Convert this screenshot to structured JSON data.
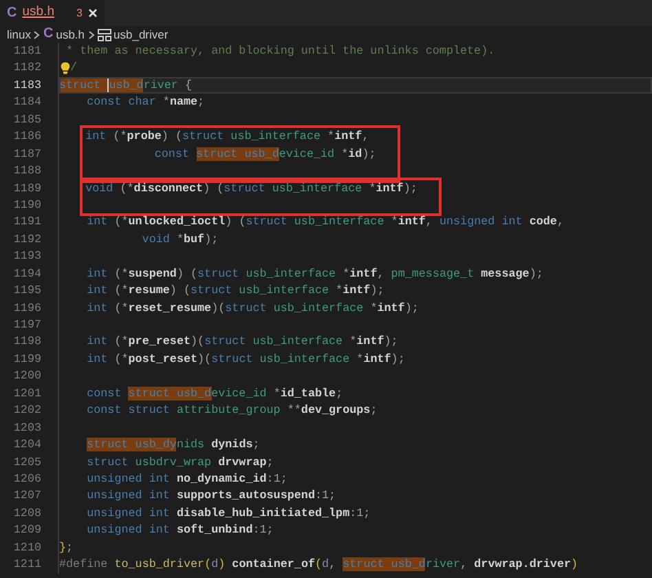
{
  "tabs": [
    {
      "icon": "C",
      "label": "usb.h",
      "problems": "3",
      "selected": true
    }
  ],
  "breadcrumb": [
    {
      "kind": "folder",
      "label": "linux"
    },
    {
      "kind": "file",
      "icon": "C",
      "label": "usb.h"
    },
    {
      "kind": "struct",
      "label": "usb_driver"
    }
  ],
  "code": {
    "blocks": [
      {
        "kind": "plain",
        "lines": [
          {
            "number": "1181",
            "selected": false,
            "tokens": [
              {
                "kind": "comment",
                "text": " * them as necessary, and blocking until the unlinks complete)."
              }
            ]
          },
          {
            "number": "1182",
            "selected": false,
            "tokens": [
              {
                "kind": "lightbulb"
              },
              {
                "kind": "comment",
                "text": "/"
              }
            ]
          },
          {
            "number": "1183",
            "selected": true,
            "tokens": [
              {
                "kind": "match",
                "text": "struct "
              },
              {
                "kind": "cursor"
              },
              {
                "kind": "match",
                "text": "usb_d"
              },
              {
                "kind": "type",
                "text": "river"
              },
              {
                "kind": "punct",
                "text": " {"
              }
            ]
          },
          {
            "number": "1184",
            "selected": false,
            "tokens": [
              {
                "kind": "keyword",
                "text": "    const char"
              },
              {
                "kind": "punct",
                "text": " *"
              },
              {
                "kind": "field",
                "text": "name"
              },
              {
                "kind": "punct",
                "text": ";"
              }
            ]
          },
          {
            "number": "1185",
            "selected": false
          }
        ]
      },
      {
        "kind": "boxed",
        "lines": [
          {
            "number": "1186",
            "selected": false,
            "tokens": [
              {
                "kind": "keyword",
                "text": "    int"
              },
              {
                "kind": "punct",
                "text": " (*"
              },
              {
                "kind": "field",
                "text": "probe"
              },
              {
                "kind": "punct",
                "text": ") ("
              },
              {
                "kind": "keyword",
                "text": "struct"
              },
              {
                "kind": "type",
                "text": " usb_interface"
              },
              {
                "kind": "punct",
                "text": " *"
              },
              {
                "kind": "field",
                "text": "intf"
              },
              {
                "kind": "punct",
                "text": ","
              }
            ]
          },
          {
            "number": "1187",
            "selected": false,
            "tokens": [
              {
                "kind": "keyword",
                "text": "              const "
              },
              {
                "kind": "match",
                "text": "struct usb_d"
              },
              {
                "kind": "type",
                "text": "evice_id"
              },
              {
                "kind": "punct",
                "text": " *"
              },
              {
                "kind": "field",
                "text": "id"
              },
              {
                "kind": "punct",
                "text": ");"
              }
            ]
          },
          {
            "number": "1188",
            "selected": false
          }
        ]
      },
      {
        "kind": "boxed",
        "lines": [
          {
            "number": "1189",
            "selected": false,
            "tokens": [
              {
                "kind": "keyword",
                "text": "    void"
              },
              {
                "kind": "punct",
                "text": " (*"
              },
              {
                "kind": "field",
                "text": "disconnect"
              },
              {
                "kind": "punct",
                "text": ") ("
              },
              {
                "kind": "keyword",
                "text": "struct"
              },
              {
                "kind": "type",
                "text": " usb_interface"
              },
              {
                "kind": "punct",
                "text": " *"
              },
              {
                "kind": "field",
                "text": "intf"
              },
              {
                "kind": "punct",
                "text": ");"
              }
            ]
          },
          {
            "number": "1190",
            "selected": false
          }
        ]
      },
      {
        "kind": "plain",
        "lines": [
          {
            "number": "1191",
            "selected": false,
            "tokens": [
              {
                "kind": "keyword",
                "text": "    int"
              },
              {
                "kind": "punct",
                "text": " (*"
              },
              {
                "kind": "field",
                "text": "unlocked_ioctl"
              },
              {
                "kind": "punct",
                "text": ") ("
              },
              {
                "kind": "keyword",
                "text": "struct"
              },
              {
                "kind": "type",
                "text": " usb_interface"
              },
              {
                "kind": "punct",
                "text": " *"
              },
              {
                "kind": "field",
                "text": "intf"
              },
              {
                "kind": "punct",
                "text": ","
              },
              {
                "kind": "keyword",
                "text": " unsigned int"
              },
              {
                "kind": "field",
                "text": " code"
              },
              {
                "kind": "punct",
                "text": ","
              }
            ]
          },
          {
            "number": "1192",
            "selected": false,
            "tokens": [
              {
                "kind": "keyword",
                "text": "            void"
              },
              {
                "kind": "punct",
                "text": " *"
              },
              {
                "kind": "field",
                "text": "buf"
              },
              {
                "kind": "punct",
                "text": ");"
              }
            ]
          },
          {
            "number": "1193",
            "selected": false
          },
          {
            "number": "1194",
            "selected": false,
            "tokens": [
              {
                "kind": "keyword",
                "text": "    int"
              },
              {
                "kind": "punct",
                "text": " (*"
              },
              {
                "kind": "field",
                "text": "suspend"
              },
              {
                "kind": "punct",
                "text": ") ("
              },
              {
                "kind": "keyword",
                "text": "struct"
              },
              {
                "kind": "type",
                "text": " usb_interface"
              },
              {
                "kind": "punct",
                "text": " *"
              },
              {
                "kind": "field",
                "text": "intf"
              },
              {
                "kind": "punct",
                "text": ","
              },
              {
                "kind": "type",
                "text": " pm_message_t"
              },
              {
                "kind": "field",
                "text": " message"
              },
              {
                "kind": "punct",
                "text": ");"
              }
            ]
          },
          {
            "number": "1195",
            "selected": false,
            "tokens": [
              {
                "kind": "keyword",
                "text": "    int"
              },
              {
                "kind": "punct",
                "text": " (*"
              },
              {
                "kind": "field",
                "text": "resume"
              },
              {
                "kind": "punct",
                "text": ") ("
              },
              {
                "kind": "keyword",
                "text": "struct"
              },
              {
                "kind": "type",
                "text": " usb_interface"
              },
              {
                "kind": "punct",
                "text": " *"
              },
              {
                "kind": "field",
                "text": "intf"
              },
              {
                "kind": "punct",
                "text": ");"
              }
            ]
          },
          {
            "number": "1196",
            "selected": false,
            "tokens": [
              {
                "kind": "keyword",
                "text": "    int"
              },
              {
                "kind": "punct",
                "text": " (*"
              },
              {
                "kind": "field",
                "text": "reset_resume"
              },
              {
                "kind": "punct",
                "text": ")("
              },
              {
                "kind": "keyword",
                "text": "struct"
              },
              {
                "kind": "type",
                "text": " usb_interface"
              },
              {
                "kind": "punct",
                "text": " *"
              },
              {
                "kind": "field",
                "text": "intf"
              },
              {
                "kind": "punct",
                "text": ");"
              }
            ]
          },
          {
            "number": "1197",
            "selected": false
          },
          {
            "number": "1198",
            "selected": false,
            "tokens": [
              {
                "kind": "keyword",
                "text": "    int"
              },
              {
                "kind": "punct",
                "text": " (*"
              },
              {
                "kind": "field",
                "text": "pre_reset"
              },
              {
                "kind": "punct",
                "text": ")("
              },
              {
                "kind": "keyword",
                "text": "struct"
              },
              {
                "kind": "type",
                "text": " usb_interface"
              },
              {
                "kind": "punct",
                "text": " *"
              },
              {
                "kind": "field",
                "text": "intf"
              },
              {
                "kind": "punct",
                "text": ");"
              }
            ]
          },
          {
            "number": "1199",
            "selected": false,
            "tokens": [
              {
                "kind": "keyword",
                "text": "    int"
              },
              {
                "kind": "punct",
                "text": " (*"
              },
              {
                "kind": "field",
                "text": "post_reset"
              },
              {
                "kind": "punct",
                "text": ")("
              },
              {
                "kind": "keyword",
                "text": "struct"
              },
              {
                "kind": "type",
                "text": " usb_interface"
              },
              {
                "kind": "punct",
                "text": " *"
              },
              {
                "kind": "field",
                "text": "intf"
              },
              {
                "kind": "punct",
                "text": ");"
              }
            ]
          },
          {
            "number": "1200",
            "selected": false
          },
          {
            "number": "1201",
            "selected": false,
            "tokens": [
              {
                "kind": "keyword",
                "text": "    const "
              },
              {
                "kind": "match",
                "text": "struct usb_d"
              },
              {
                "kind": "type",
                "text": "evice_id"
              },
              {
                "kind": "punct",
                "text": " *"
              },
              {
                "kind": "field",
                "text": "id_table"
              },
              {
                "kind": "punct",
                "text": ";"
              }
            ]
          },
          {
            "number": "1202",
            "selected": false,
            "tokens": [
              {
                "kind": "keyword",
                "text": "    const struct"
              },
              {
                "kind": "type",
                "text": " attribute_group"
              },
              {
                "kind": "punct",
                "text": " **"
              },
              {
                "kind": "field",
                "text": "dev_groups"
              },
              {
                "kind": "punct",
                "text": ";"
              }
            ]
          },
          {
            "number": "1203",
            "selected": false
          },
          {
            "number": "1204",
            "selected": false,
            "tokens": [
              {
                "kind": "match",
                "text": "    struct usb_dy"
              },
              {
                "kind": "type",
                "text": "nids"
              },
              {
                "kind": "field",
                "text": " dynids"
              },
              {
                "kind": "punct",
                "text": ";"
              }
            ]
          },
          {
            "number": "1205",
            "selected": false,
            "tokens": [
              {
                "kind": "keyword",
                "text": "    struct"
              },
              {
                "kind": "type",
                "text": " usbdrv_wrap"
              },
              {
                "kind": "field",
                "text": " drvwrap"
              },
              {
                "kind": "punct",
                "text": ";"
              }
            ]
          },
          {
            "number": "1206",
            "selected": false,
            "tokens": [
              {
                "kind": "keyword",
                "text": "    unsigned int"
              },
              {
                "kind": "field",
                "text": " no_dynamic_id"
              },
              {
                "kind": "punct",
                "text": ":1;"
              }
            ]
          },
          {
            "number": "1207",
            "selected": false,
            "tokens": [
              {
                "kind": "keyword",
                "text": "    unsigned int"
              },
              {
                "kind": "field",
                "text": " supports_autosuspend"
              },
              {
                "kind": "punct",
                "text": ":1;"
              }
            ]
          },
          {
            "number": "1208",
            "selected": false,
            "tokens": [
              {
                "kind": "keyword",
                "text": "    unsigned int"
              },
              {
                "kind": "field",
                "text": " disable_hub_initiated_lpm"
              },
              {
                "kind": "punct",
                "text": ":1;"
              }
            ]
          },
          {
            "number": "1209",
            "selected": false,
            "tokens": [
              {
                "kind": "keyword",
                "text": "    unsigned int"
              },
              {
                "kind": "field",
                "text": " soft_unbind"
              },
              {
                "kind": "punct",
                "text": ":1;"
              }
            ]
          },
          {
            "number": "1210",
            "selected": false,
            "tokens": [
              {
                "kind": "bracket",
                "text": "}"
              },
              {
                "kind": "punct",
                "text": ";"
              }
            ]
          },
          {
            "number": "1211",
            "selected": false,
            "tokens": [
              {
                "kind": "macro",
                "text": "#define"
              },
              {
                "kind": "function",
                "text": " to_usb_driver"
              },
              {
                "kind": "bracket",
                "text": "("
              },
              {
                "kind": "param",
                "text": "d"
              },
              {
                "kind": "bracket",
                "text": ")"
              },
              {
                "kind": "field",
                "text": " container_of"
              },
              {
                "kind": "bracket",
                "text": "("
              },
              {
                "kind": "param",
                "text": "d"
              },
              {
                "kind": "punct",
                "text": ", "
              },
              {
                "kind": "match",
                "text": "struct usb_d"
              },
              {
                "kind": "type",
                "text": "river"
              },
              {
                "kind": "punct",
                "text": ", "
              },
              {
                "kind": "field",
                "text": "drvwrap.driver"
              },
              {
                "kind": "bracket",
                "text": ")"
              }
            ]
          }
        ]
      }
    ]
  }
}
